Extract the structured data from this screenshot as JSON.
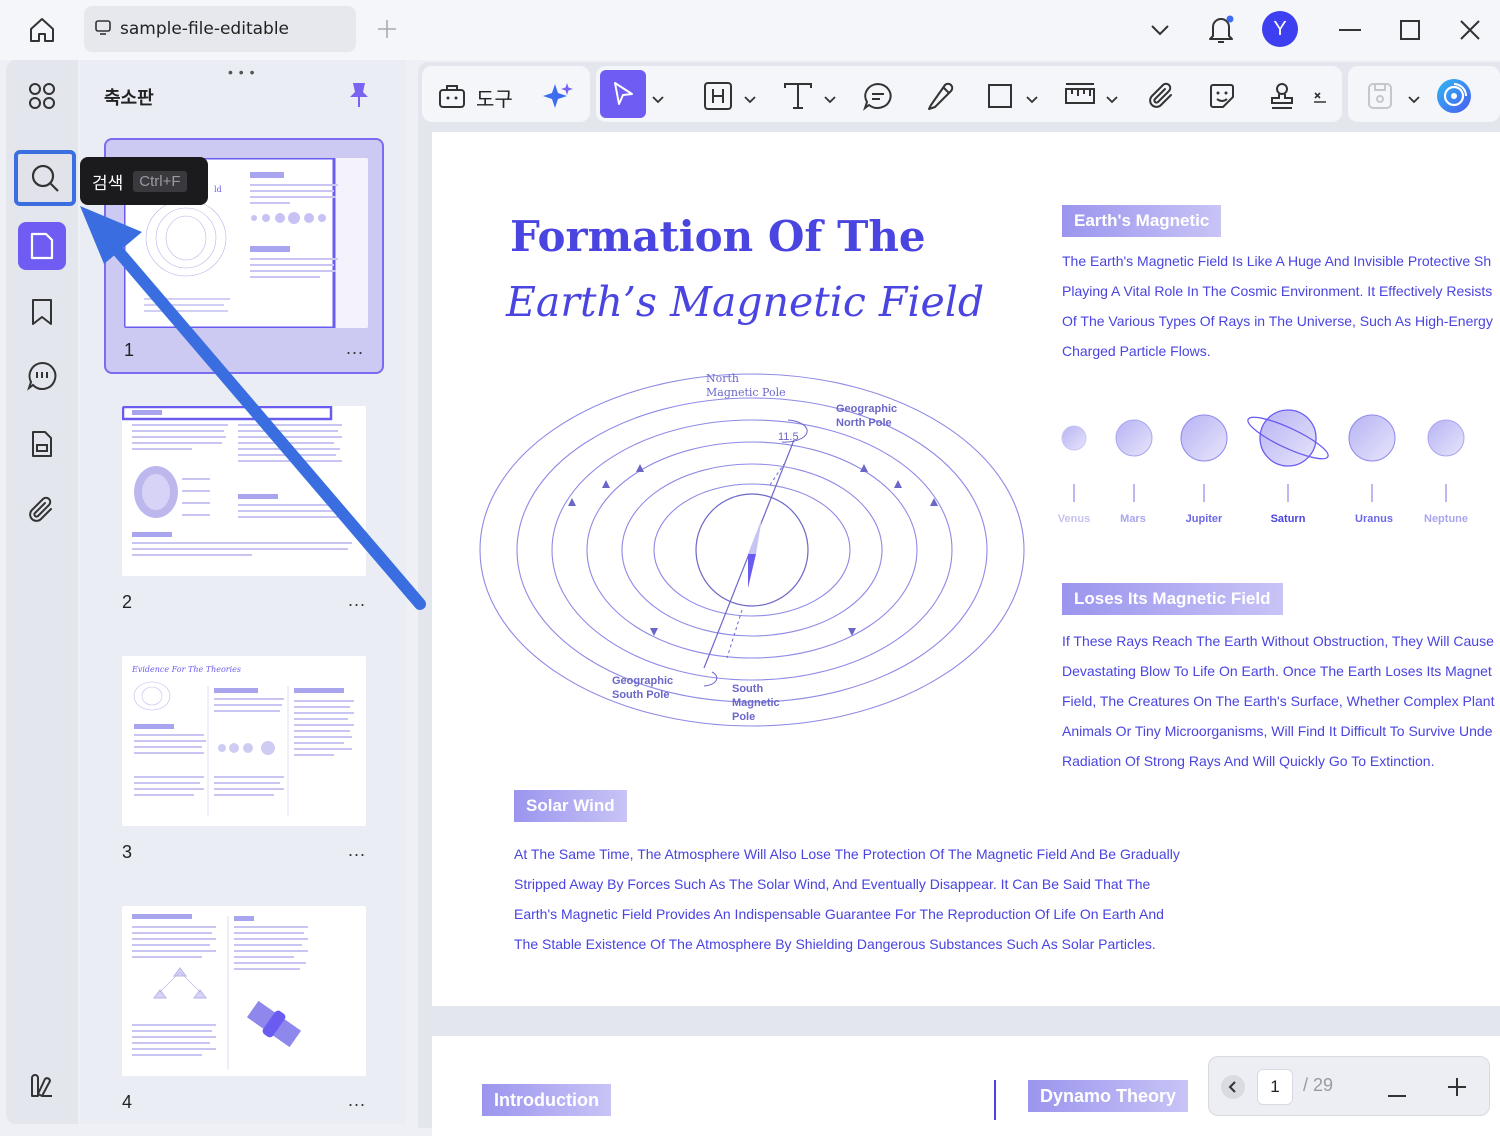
{
  "titlebar": {
    "tab_name": "sample-file-editable",
    "avatar_letter": "Y"
  },
  "sidebar": {
    "panel_title": "축소판",
    "tooltip_label": "검색",
    "tooltip_shortcut": "Ctrl+F",
    "thumbnails": [
      {
        "number": "1",
        "more": "..."
      },
      {
        "number": "2",
        "more": "..."
      },
      {
        "number": "3",
        "more": "..."
      },
      {
        "number": "4",
        "more": "..."
      }
    ],
    "thumb3_title": "Evidence For The Theories"
  },
  "toolbar": {
    "tools_label": "도구"
  },
  "document": {
    "title_line1": "Formation Of The",
    "title_line2": "Earth’s Magnetic Field",
    "section1_tag": "Earth's Magnetic",
    "section1_lines": [
      "The Earth's Magnetic Field Is Like A Huge And Invisible Protective Sh",
      "Playing A Vital Role In The Cosmic Environment. It Effectively Resists",
      "Of The Various Types Of Rays in The Universe, Such As High-Energy",
      "Charged Particle Flows."
    ],
    "planets": [
      "Venus",
      "Mars",
      "Jupiter",
      "Saturn",
      "Uranus",
      "Neptune"
    ],
    "section2_tag": "Loses Its Magnetic Field",
    "section2_lines": [
      "If These Rays Reach The Earth Without Obstruction, They Will Cause",
      "Devastating Blow To Life On Earth. Once The Earth Loses Its Magnet",
      "Field, The Creatures On The Earth's Surface, Whether Complex Plant",
      "Animals Or Tiny Microorganisms, Will Find It Difficult To Survive Unde",
      "Radiation Of Strong Rays And Will Quickly Go To Extinction."
    ],
    "diagram": {
      "north_magnetic_pole_1": "North",
      "north_magnetic_pole_2": "Magnetic Pole",
      "geo_north_1": "Geographic",
      "geo_north_2": "North Pole",
      "angle": "11.5",
      "geo_south_1": "Geographic",
      "geo_south_2": "South Pole",
      "south_mag_1": "South",
      "south_mag_2": "Magnetic",
      "south_mag_3": "Pole"
    },
    "section3_tag": "Solar Wind",
    "section3_lines": [
      "At The Same Time, The Atmosphere Will Also Lose The Protection Of The Magnetic Field And Be Gradually",
      "Stripped Away By Forces Such As The Solar Wind, And Eventually Disappear. It Can Be Said That The",
      "Earth's Magnetic Field Provides An Indispensable Guarantee For The Reproduction Of Life On Earth And",
      "The Stable Existence Of The Atmosphere By Shielding Dangerous Substances Such As Solar Particles."
    ],
    "page2_tag_left": "Introduction",
    "page2_tag_right": "Dynamo Theory"
  },
  "pager": {
    "current": "1",
    "total": "/ 29"
  },
  "colors": {
    "accent": "#4a44e0",
    "highlight": "#3b6fe0",
    "arrow": "#3a6ee0"
  }
}
